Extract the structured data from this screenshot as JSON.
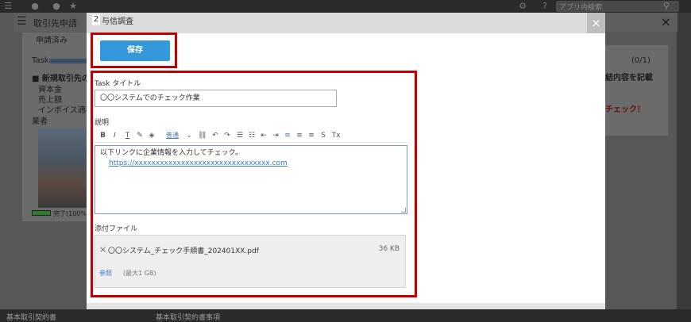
{
  "background": {
    "search_placeholder": "アプリ内検索",
    "panel_title": "取引先申請",
    "status_tag": "申請済み",
    "task_label": "Task",
    "card_heading": "■ 新規取引先の",
    "card_rows": [
      "資本金",
      "売上額",
      "インボイス適格",
      "業者"
    ],
    "progress_label": "完了(100%)",
    "right_count": "(0/1)",
    "right_heading": "結内容を記載",
    "right_alert": "チェック！",
    "footer_left": "基本取引契約書",
    "footer_right": "基本取引契約書事項"
  },
  "modal": {
    "number": "2",
    "title": "与信調査",
    "close": "×",
    "save_label": "保存",
    "task_title_label": "Task タイトル",
    "task_title_value": "〇〇システムでのチェック作業",
    "description_label": "説明",
    "toolbar": {
      "bold": "B",
      "italic": "I",
      "text": "T",
      "font_size": "普通",
      "dropdown": "⌄"
    },
    "description_text": "以下リンクに企業情報を入力してチェック。",
    "description_link": "https://xxxxxxxxxxxxxxxxxxxxxxxxxxxxxxxx.com",
    "attachment_label": "添付ファイル",
    "file_name": "〇〇システム_チェック手順書_202401XX.pdf",
    "file_size": "36 KB",
    "remove_icon": "×",
    "browse_label": "参照",
    "max_size": "(最大1 GB)"
  },
  "colors": {
    "accent": "#3498db",
    "highlight": "#c00000",
    "link": "#3b7ac9"
  }
}
